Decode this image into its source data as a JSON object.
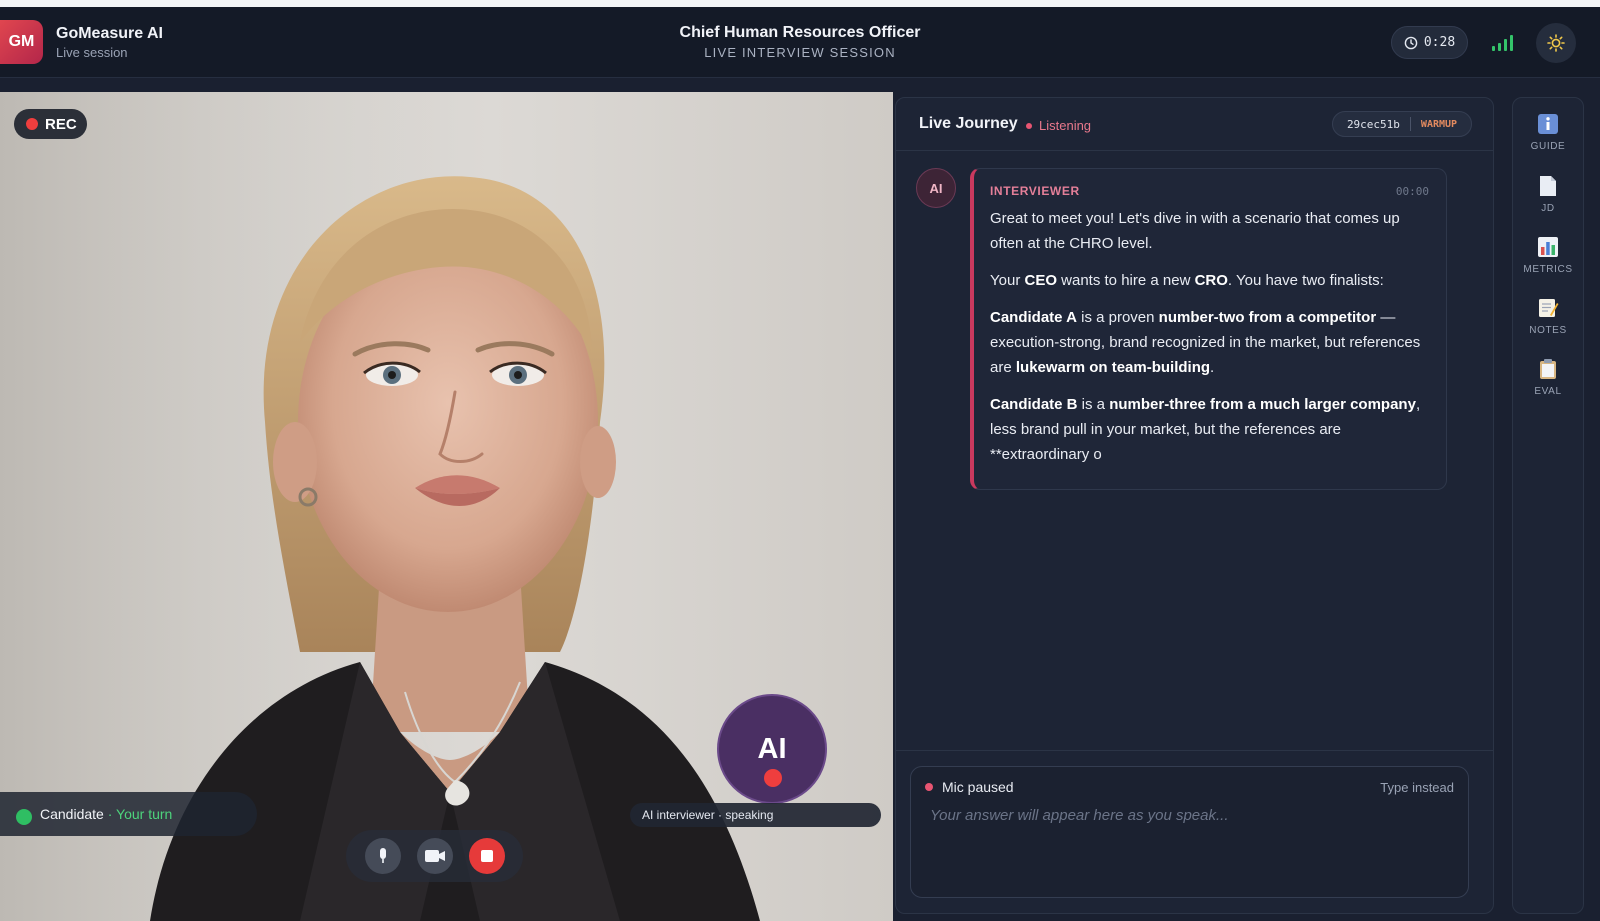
{
  "app": {
    "logo_initials": "GM",
    "name": "GoMeasure AI",
    "subtitle": "Live session"
  },
  "session": {
    "title": "Chief Human Resources Officer",
    "subtitle": "LIVE INTERVIEW SESSION",
    "timer": "0:28"
  },
  "video": {
    "rec_label": "REC",
    "candidate_name": "Candidate",
    "candidate_status": " · Your turn",
    "ai_avatar_initials": "AI",
    "ai_label": "AI interviewer · speaking"
  },
  "journey": {
    "title": "Live Journey",
    "status": "Listening",
    "session_id": "29cec51b",
    "stage": "WARMUP",
    "message": {
      "avatar": "AI",
      "role": "INTERVIEWER",
      "time": "00:00",
      "p1": "Great to meet you! Let's dive in with a scenario that comes up often at the CHRO level.",
      "p2a": "Your ",
      "p2b": "CEO",
      "p2c": " wants to hire a new ",
      "p2d": "CRO",
      "p2e": ". You have two finalists:",
      "p3a": "Candidate A",
      "p3b": " is a proven ",
      "p3c": "number-two from a competitor",
      "p3d": " — execution-strong, brand recognized in the market, but references are ",
      "p3e": "lukewarm on team-building",
      "p3f": ".",
      "p4a": "Candidate B",
      "p4b": " is a ",
      "p4c": "number-three from a much larger company",
      "p4d": ", less brand pull in your market, but the references are **extraordinary o"
    },
    "answer": {
      "mic_status": "Mic paused",
      "type_instead": "Type instead",
      "placeholder": "Your answer will appear here as you speak..."
    }
  },
  "rail": {
    "items": [
      {
        "label": "GUIDE",
        "icon": "info-icon"
      },
      {
        "label": "JD",
        "icon": "document-icon"
      },
      {
        "label": "METRICS",
        "icon": "bar-chart-icon"
      },
      {
        "label": "NOTES",
        "icon": "memo-icon"
      },
      {
        "label": "EVAL",
        "icon": "clipboard-icon"
      }
    ]
  },
  "colors": {
    "accent": "#c9395e",
    "listening": "#e8788c",
    "success": "#2fbe63",
    "rec": "#ef3e3e"
  }
}
